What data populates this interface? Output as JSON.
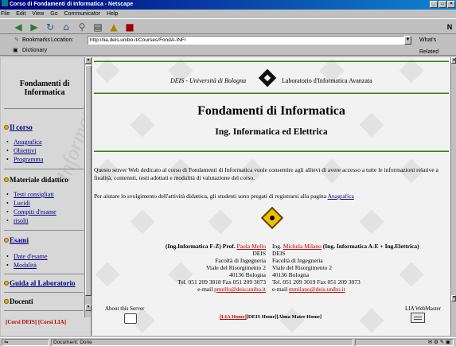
{
  "window": {
    "title": "Corso di Fondamenti di Informatica - Netscape"
  },
  "menu": [
    "File",
    "Edit",
    "View",
    "Go",
    "Communicator",
    "Help"
  ],
  "toolbar": {
    "icons": [
      "back-arrow-icon",
      "forward-arrow-icon",
      "reload-icon",
      "home-icon",
      "search-icon",
      "print-icon",
      "security-icon",
      "stop-icon"
    ],
    "logo": "N"
  },
  "location": {
    "bookmarks_label": "Bookmarks",
    "location_label": "Location:",
    "url": "http://lia.deis.unibo.it/Courses/FondA-INF/",
    "whats_related": "What's Related"
  },
  "personal": {
    "dictionary_label": "Dictionary"
  },
  "left": {
    "title": "Fondamenti di Informatica",
    "watermark": "Informatica ed",
    "sections": [
      {
        "label": "Il corso",
        "link": true,
        "items": [
          "Anagrafica",
          "Obiettivi",
          "Programma"
        ]
      },
      {
        "label": "Materiale didattico",
        "link": false,
        "items": [
          "Testi consigliati",
          "Lucidi",
          "Compiti d'esame",
          "risolti"
        ]
      },
      {
        "label": "Esami",
        "link": true,
        "items": [
          "Date d'esame",
          "Modalità"
        ]
      },
      {
        "label": "Guida al Laboratorio",
        "link": true,
        "items": []
      },
      {
        "label": "Docenti",
        "link": false,
        "items": []
      }
    ],
    "bottom_links": "[Corsi DEIS] [Corsi LIA]"
  },
  "main": {
    "header_left": "DEIS - Università di Bologna",
    "header_right": "Laboratorio d'Informatica Avanzata",
    "title": "Fondamenti di Informatica",
    "subtitle": "Ing. Informatica ed Elettrica",
    "paragraph1": "Questo server Web dedicato al corso di Fondamenti di Informatica vuole consentire agli allievi di avere accesso a tutte le informazioni relative a finalità, contenuti, testi adottati e modalità di valutazione del corso.",
    "paragraph2_pre": "Per aiutare lo svolgimento dell'attività didattica, gli studenti sono pregati di registrarsi alla pagina",
    "paragraph2_link": "Anagrafica",
    "contact_left": {
      "role": "(Ing.Informatica F-Z) Prof.",
      "name": "Paola Mello",
      "dept": "DEIS",
      "faculty": "Facoltà di Ingegneria",
      "street": "Viale del Risorgimento 2",
      "city": "40136 Bologna",
      "phone": "Tel. 051 209 3818 Fax 051 209 3073",
      "email_label": "e-mail",
      "email": "pmello@deis.unibo.it"
    },
    "contact_right": {
      "role_pre": "Ing.",
      "name": "Michela Milano",
      "role": "(Ing. Informatica A-E + Ing.Elettrica)",
      "dept": "DEIS",
      "faculty": "Facoltà di Ingegneria",
      "street": "Viale del Risorgimento 2",
      "city": "40136 Bologna",
      "phone": "Tel. 051 209 3019 Fax 051 209 3073",
      "email_label": "e-mail",
      "email": "mmilano@deis.unibo.it"
    },
    "about_label": "About this Server",
    "webmaster_label": "LIA WebMaster",
    "footer_links": {
      "lia": "[LIA Home]",
      "deis": "[DEIS Home]",
      "alma": "[Alma Mater Home]"
    }
  },
  "status": {
    "text": "Document: Done"
  },
  "colors": {
    "link": "#000080",
    "accent_red": "#c00000",
    "rule": "#7fc05a"
  }
}
